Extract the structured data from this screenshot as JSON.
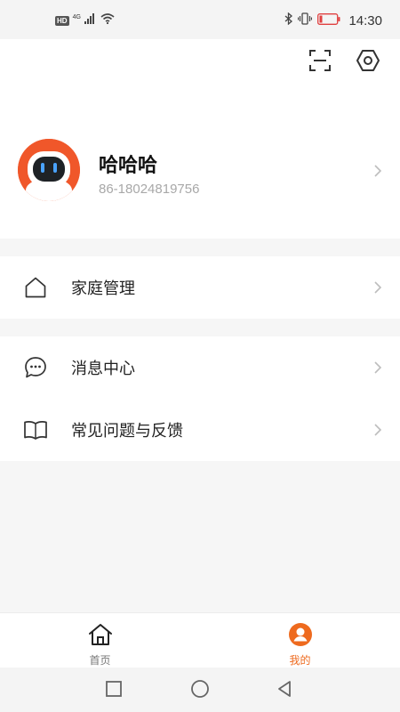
{
  "status_bar": {
    "hd": "HD",
    "network": "4G",
    "time": "14:30"
  },
  "header": {
    "scan_icon": "scan-icon",
    "settings_icon": "settings-hexagon-icon"
  },
  "profile": {
    "name": "哈哈哈",
    "phone": "86-18024819756",
    "avatar_icon": "robot-avatar-icon"
  },
  "menu": {
    "home_management": {
      "label": "家庭管理",
      "icon": "house-icon"
    },
    "message_center": {
      "label": "消息中心",
      "icon": "chat-bubble-icon"
    },
    "faq_feedback": {
      "label": "常见问题与反馈",
      "icon": "book-icon"
    }
  },
  "tabs": {
    "home": {
      "label": "首页",
      "icon": "home-icon"
    },
    "mine": {
      "label": "我的",
      "icon": "user-icon",
      "active": true
    }
  },
  "colors": {
    "accent": "#ee6a1e",
    "avatar_bg": "#f0572a",
    "page_bg": "#f6f6f6"
  }
}
